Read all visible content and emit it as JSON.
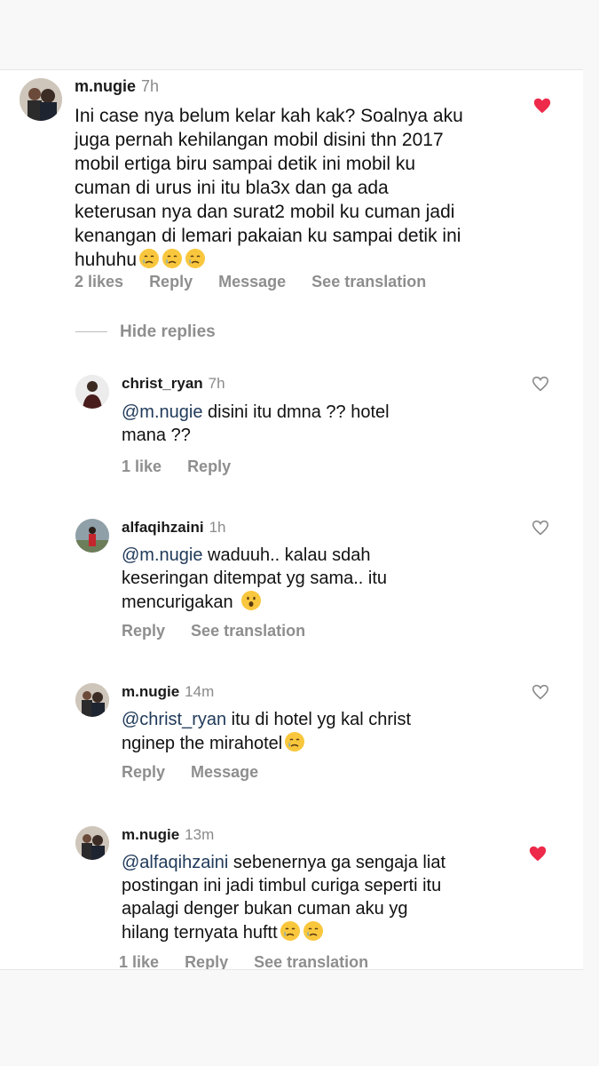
{
  "comments": [
    {
      "username": "m.nugie",
      "time": "7h",
      "text_lines": [
        "Ini case nya belum kelar kah kak? Soalnya aku",
        "juga pernah kehilangan mobil disini thn 2017",
        "mobil ertiga biru sampai detik ini mobil ku",
        "cuman di urus ini itu bla3x dan ga ada",
        "keterusan nya dan surat2 mobil ku cuman jadi",
        "kenangan di lemari pakaian ku sampai detik ini",
        "huhuhu"
      ],
      "likes": "2 likes",
      "reply": "Reply",
      "message": "Message",
      "see_translation": "See translation",
      "liked": true
    },
    {
      "username": "christ_ryan",
      "time": "7h",
      "mention": "@m.nugie",
      "text_lines": [
        " disini itu dmna ?? hotel",
        "mana ??"
      ],
      "likes": "1 like",
      "reply": "Reply",
      "liked": false
    },
    {
      "username": "alfaqihzaini",
      "time": "1h",
      "mention": "@m.nugie",
      "text_lines": [
        " waduuh.. kalau sdah",
        "keseringan ditempat yg sama.. itu",
        "mencurigakan"
      ],
      "reply": "Reply",
      "see_translation": "See translation",
      "liked": false
    },
    {
      "username": "m.nugie",
      "time": "14m",
      "mention": "@christ_ryan",
      "text_lines": [
        " itu di hotel yg kal christ",
        "nginep the mirahotel"
      ],
      "reply": "Reply",
      "message": "Message",
      "liked": false
    },
    {
      "username": "m.nugie",
      "time": "13m",
      "mention": "@alfaqihzaini",
      "text_lines": [
        " sebenernya ga sengaja liat",
        "postingan ini jadi timbul curiga seperti itu",
        "apalagi denger bukan cuman aku yg",
        "hilang ternyata huftt"
      ],
      "likes": "1 like",
      "reply": "Reply",
      "see_translation": "See translation",
      "liked": true
    }
  ],
  "hide_replies": "Hide replies",
  "colors": {
    "heart_liked": "#ed2a4a",
    "mention": "#203a5a",
    "meta": "#8e8e8e"
  },
  "icons": [
    "heart-icon",
    "crying-face-emoji",
    "surprised-face-emoji"
  ]
}
